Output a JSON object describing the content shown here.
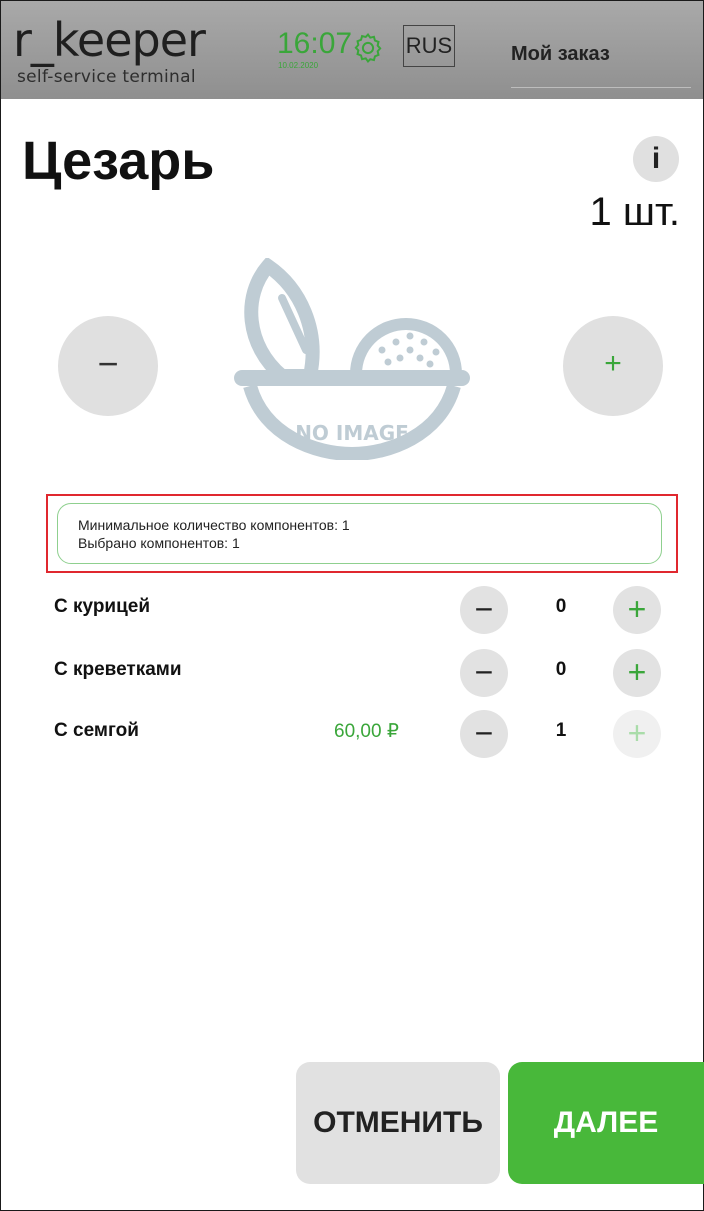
{
  "header": {
    "logo_main": "r_keeper",
    "logo_sub": "self-service terminal",
    "time": "16:07",
    "date": "10.02.2020",
    "language": "RUS",
    "order_title": "Мой заказ",
    "settings_icon": "gear-icon"
  },
  "dish": {
    "title": "Цезарь",
    "info_label": "i",
    "quantity": "1 шт.",
    "minus_label": "−",
    "plus_label": "+",
    "image_placeholder": "NO IMAGE"
  },
  "components_info": {
    "min_line": "Минимальное количество компонентов: 1",
    "selected_line": "Выбрано компонентов: 1"
  },
  "options": [
    {
      "name": "С курицей",
      "price": "",
      "count": "0",
      "plus_enabled": true
    },
    {
      "name": "С креветками",
      "price": "",
      "count": "0",
      "plus_enabled": true
    },
    {
      "name": "С семгой",
      "price": "60,00 ₽",
      "count": "1",
      "plus_enabled": false
    }
  ],
  "option_minus_label": "−",
  "option_plus_label": "+",
  "actions": {
    "cancel_label": "ОТМЕНИТЬ",
    "next_label": "ДАЛЕЕ"
  },
  "colors": {
    "accent_green": "#48b83a",
    "header_gray": "#9e9e9e",
    "highlight_red": "#e0282f"
  }
}
